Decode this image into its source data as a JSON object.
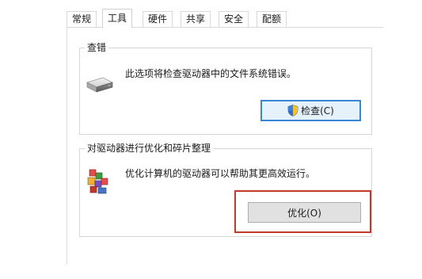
{
  "tabs": [
    {
      "label": "常规"
    },
    {
      "label": "工具",
      "active": true
    },
    {
      "label": "硬件"
    },
    {
      "label": "共享"
    },
    {
      "label": "安全"
    },
    {
      "label": "配额"
    }
  ],
  "check_group": {
    "title": "查错",
    "description": "此选项将检查驱动器中的文件系统错误。",
    "button_label": "检查(C)",
    "button_icon": "uac-shield-icon",
    "icon": "drive-icon"
  },
  "optimize_group": {
    "title": "对驱动器进行优化和碎片整理",
    "description": "优化计算机的驱动器可以帮助其更高效运行。",
    "button_label": "优化(O)",
    "icon": "defrag-icon"
  },
  "colors": {
    "highlight": "#c0392b",
    "focus_border": "#3a86d4"
  }
}
